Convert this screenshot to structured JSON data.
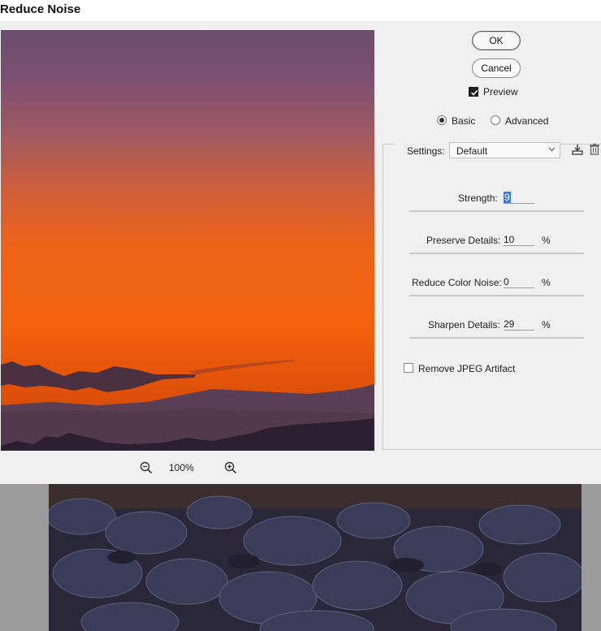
{
  "dialog": {
    "title": "Reduce Noise",
    "ok_label": "OK",
    "cancel_label": "Cancel",
    "preview_label": "Preview",
    "preview_checked": true,
    "mode": {
      "basic": "Basic",
      "advanced": "Advanced",
      "selected": "Basic"
    },
    "settings": {
      "label": "Settings:",
      "value": "Default"
    },
    "strength": {
      "label": "Strength:",
      "value": "9",
      "fraction": 0.9
    },
    "preserve_details": {
      "label": "Preserve Details:",
      "value": "10",
      "unit": "%",
      "fraction": 0.1
    },
    "reduce_color_noise": {
      "label": "Reduce Color Noise:",
      "value": "0",
      "unit": "%",
      "fraction": 0.0
    },
    "sharpen_details": {
      "label": "Sharpen Details:",
      "value": "29",
      "unit": "%",
      "fraction": 0.29
    },
    "remove_jpeg_label": "Remove JPEG Artifact",
    "remove_jpeg_checked": false,
    "zoom": "100%"
  },
  "icons": [
    "zoom-out-icon",
    "zoom-in-icon",
    "save-preset-icon",
    "delete-preset-icon",
    "checkmark-icon",
    "chevron-down-icon"
  ],
  "colors": {
    "accent": "#3c7fd6",
    "dialog_bg": "#f0f0f0",
    "sky_top": "#6c4f70",
    "sky_orange": "#f06010"
  }
}
